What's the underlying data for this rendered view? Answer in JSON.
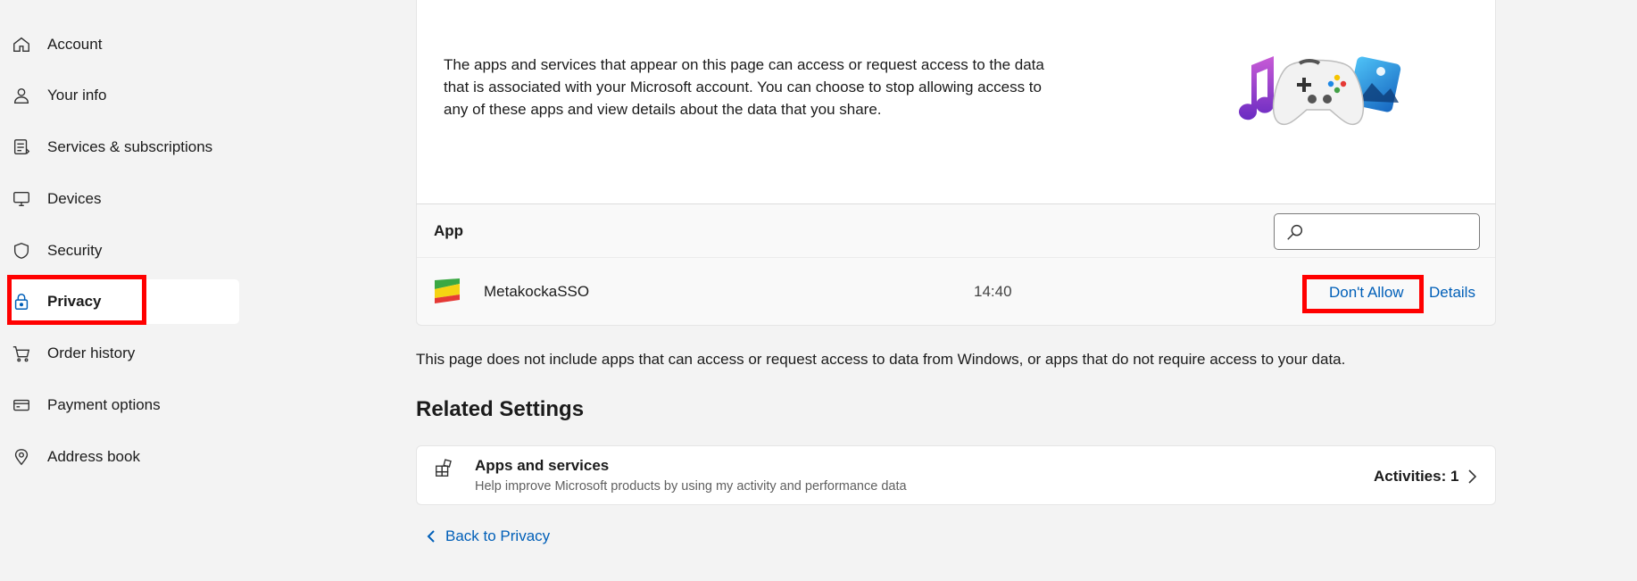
{
  "sidebar": {
    "items": [
      {
        "label": "Account",
        "icon": "home-icon"
      },
      {
        "label": "Your info",
        "icon": "person-icon"
      },
      {
        "label": "Services & subscriptions",
        "icon": "subscriptions-icon"
      },
      {
        "label": "Devices",
        "icon": "monitor-icon"
      },
      {
        "label": "Security",
        "icon": "shield-icon"
      },
      {
        "label": "Privacy",
        "icon": "lock-icon",
        "active": true
      },
      {
        "label": "Order history",
        "icon": "cart-icon"
      },
      {
        "label": "Payment options",
        "icon": "card-icon"
      },
      {
        "label": "Address book",
        "icon": "location-icon"
      }
    ]
  },
  "intro": {
    "text": "The apps and services that appear on this page can access or request access to the data that is associated with your Microsoft account. You can choose to stop allowing access to any of these apps and view details about the data that you share."
  },
  "table": {
    "column_header": "App",
    "search_placeholder": "",
    "rows": [
      {
        "name": "MetakockaSSO",
        "time": "14:40",
        "action_label": "Don't Allow",
        "details_label": "Details"
      }
    ]
  },
  "footnote": "This page does not include apps that can access or request access to data from Windows, or apps that do not require access to your data.",
  "related": {
    "title": "Related Settings",
    "items": [
      {
        "name": "Apps and services",
        "description": "Help improve Microsoft products by using my activity and performance data",
        "value": "Activities: 1"
      }
    ]
  },
  "back_link": "Back to Privacy",
  "colors": {
    "accent": "#005fb8",
    "highlight": "#ff0000",
    "background": "#f3f3f3"
  }
}
